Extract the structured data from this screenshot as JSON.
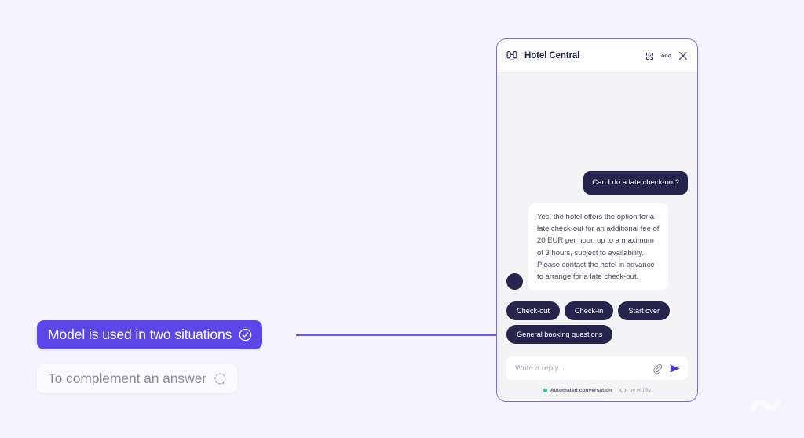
{
  "theme": {
    "page_background": "#F5F3FD",
    "accent_purple": "#5B46E8",
    "widget_border": "#7A63EF",
    "dark_navy": "#23254D",
    "chat_background": "#F4F4F6",
    "status_green": "#17C98A"
  },
  "annotations": {
    "primary": {
      "label": "Model is used in two situations",
      "icon": "check-circle-icon"
    },
    "secondary": {
      "label": "To complement an answer",
      "icon": "dashed-circle-icon"
    }
  },
  "widget": {
    "header": {
      "logo_icon": "hotel-logo-icon",
      "title": "Hotel Central",
      "actions": [
        {
          "name": "expand-icon",
          "label": "Expand"
        },
        {
          "name": "more-options-icon",
          "label": "More options"
        },
        {
          "name": "close-icon",
          "label": "Close"
        }
      ]
    },
    "messages": [
      {
        "sender": "user",
        "text": "Can I do a late check-out?"
      },
      {
        "sender": "bot",
        "avatar": "bot-avatar",
        "text": "Yes, the hotel offers the option for a late check-out for an additional fee of 20 EUR per hour, up to a maximum of 3 hours, subject to availability. Please contact the hotel in advance to arrange for a late check-out."
      }
    ],
    "quick_replies": [
      "Check-out",
      "Check-in",
      "Start over",
      "General booking questions"
    ],
    "composer": {
      "placeholder": "Write a reply...",
      "value": "",
      "attach_icon": "paperclip-icon",
      "send_icon": "send-icon"
    },
    "footer": {
      "status_text": "Automated conversation",
      "separator": "|",
      "code_icon": "code-icon",
      "credit": "by HiJiffy"
    }
  },
  "watermark": {
    "icon": "infinity-loop-logo"
  }
}
